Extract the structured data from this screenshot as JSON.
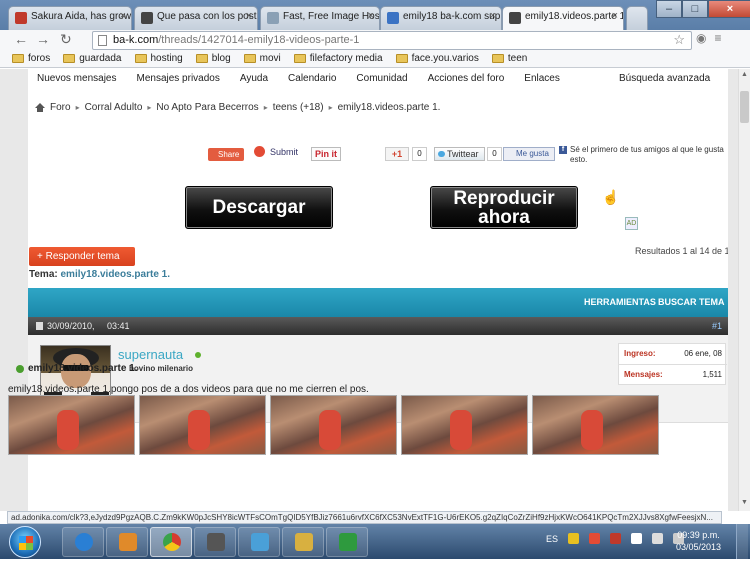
{
  "browser": {
    "tabs": [
      {
        "title": "Sakura Aida, has grow",
        "color": "#c0392b"
      },
      {
        "title": "Que pasa con los post",
        "color": "#444444"
      },
      {
        "title": "Fast, Free Image Hosti",
        "color": "#8aa0b5"
      },
      {
        "title": "emily18 ba-k.com sup",
        "color": "#3b73c4"
      },
      {
        "title": "emily18.videos.parte 1",
        "color": "#444444"
      }
    ],
    "url_host": "ba-k.com",
    "url_path": "/threads/1427014-emily18-videos-parte-1",
    "bookmarks": [
      "foros",
      "guardada",
      "hosting",
      "blog",
      "movi",
      "filefactory media",
      "face.you.varios",
      "teen"
    ],
    "status_url": "ad.adonika.com/clk?3,eJydzd9PgzAQB.C.Zm9kKW0pJcSHY8icWTFsCOmTgQID5YfBJiz7661u6rvfXC6fXC53NvExtTF1G-U6rEKO5.g2qZIqCoZrZiHf9zHjxKWcO641KPQcTm2XJJvs8XgfwFeesjxN..."
  },
  "forum": {
    "nav": [
      "Nuevos mensajes",
      "Mensajes privados",
      "Ayuda",
      "Calendario",
      "Comunidad",
      "Acciones del foro",
      "Enlaces"
    ],
    "advanced_search": "Búsqueda avanzada",
    "breadcrumbs": [
      "Foro",
      "Corral Adulto",
      "No Apto Para Becerros",
      "teens (+18)",
      "emily18.videos.parte 1."
    ],
    "social": {
      "share": "Share",
      "submit": "Submit",
      "pinit": "Pin it",
      "gplus": "+1",
      "gplus_count": "0",
      "tweet": "Twittear",
      "tweet_count": "0",
      "like": "Me gusta",
      "fb_text": "Sé el primero de tus amigos al que le gusta esto."
    },
    "download_button": "Descargar",
    "play_button": "Reproducir ahora",
    "ad_badge": "AD",
    "reply_button": "+ Responder tema",
    "results": "Resultados 1 al 14 de 1",
    "topic_label": "Tema:",
    "topic_title": "emily18.videos.parte 1.",
    "tools": "HERRAMIENTAS",
    "search_topic": "BUSCAR TEMA",
    "post": {
      "date": "30/09/2010,",
      "time": "03:41",
      "number": "#1",
      "username": "supernauta",
      "rank": "bovino milenario",
      "joined_label": "Ingreso:",
      "joined_value": "06 ene, 08",
      "posts_label": "Mensajes:",
      "posts_value": "1,511",
      "title": "emily18.videos.parte 1.",
      "body": "emily18.videos.parte 1.pongo pos de a dos videos para que no me cierren el pos."
    }
  },
  "taskbar": {
    "lang": "ES",
    "time": "09:39 p.m.",
    "date": "03/05/2013",
    "app_colors": [
      "#2a7fd4",
      "#e08a2a",
      "#3aa34a",
      "#555555",
      "#4aa0d8",
      "#d8b040",
      "#2e9a3e"
    ]
  }
}
